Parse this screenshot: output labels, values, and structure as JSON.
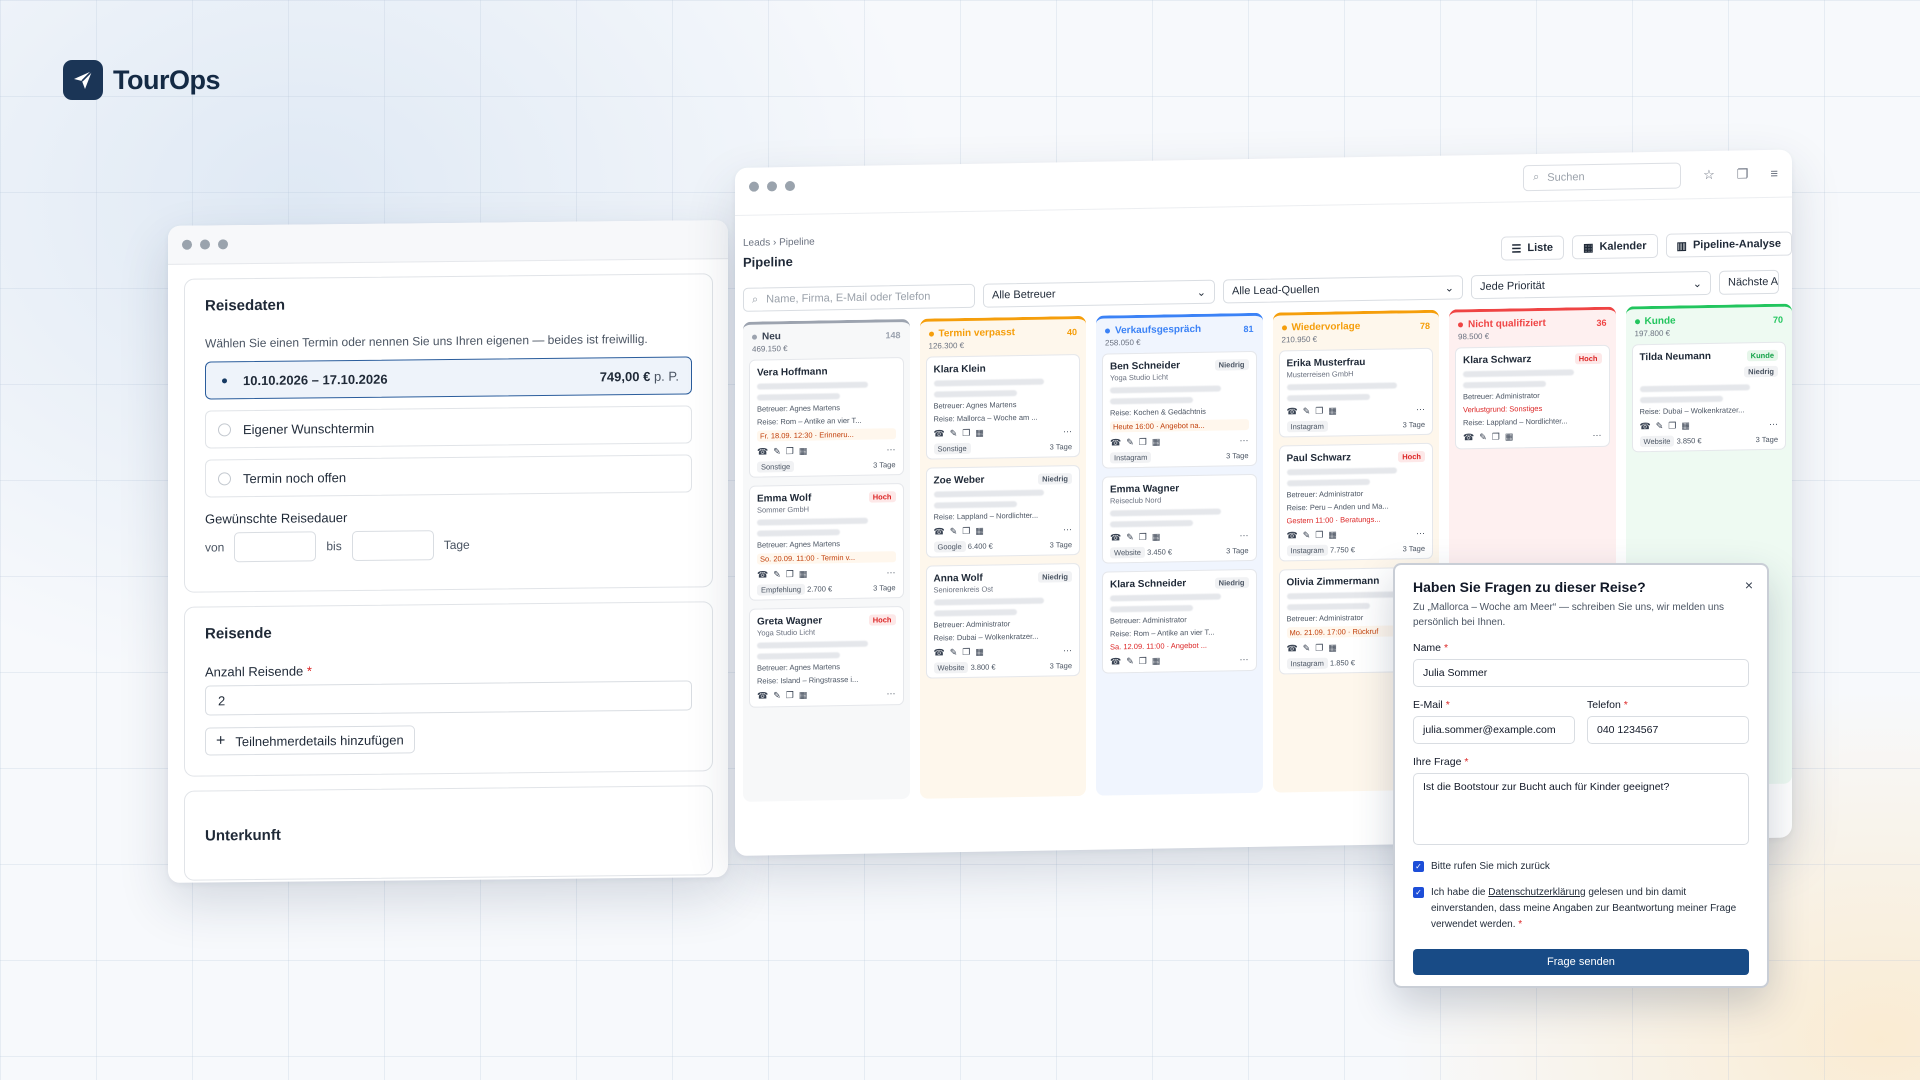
{
  "brand": {
    "name": "TourOps"
  },
  "form": {
    "reisedaten": {
      "title": "Reisedaten",
      "hint": "Wählen Sie einen Termin oder nennen Sie uns Ihren eigenen — beides ist freiwillig.",
      "options": [
        {
          "label": "10.10.2026 – 17.10.2026",
          "price": "749,00 €",
          "unit": "p. P."
        },
        {
          "label": "Eigener Wunschtermin"
        },
        {
          "label": "Termin noch offen"
        }
      ],
      "duration_label": "Gewünschte Reisedauer",
      "from": "von",
      "to": "bis",
      "unit": "Tage"
    },
    "reisende": {
      "title": "Reisende",
      "count_label": "Anzahl Reisende",
      "count_value": "2",
      "add_label": "Teilnehmerdetails hinzufügen"
    },
    "unterkunft": {
      "title": "Unterkunft"
    }
  },
  "pipeline": {
    "search_placeholder": "Suchen",
    "breadcrumb": [
      "Leads",
      "Pipeline"
    ],
    "title": "Pipeline",
    "views": [
      "Liste",
      "Kalender",
      "Pipeline-Analyse"
    ],
    "filters": {
      "search": "Name, Firma, E-Mail oder Telefon",
      "betreuer": "Alle Betreuer",
      "quellen": "Alle Lead-Quellen",
      "prio": "Jede Priorität",
      "next": "Nächste Ak"
    },
    "columns": [
      {
        "name": "Neu",
        "count": "148",
        "sum": "469.150 €",
        "color": "#9ca3af",
        "cards": [
          {
            "name": "Vera Hoffmann",
            "tag": "",
            "sub": "",
            "lines": [
              "Betreuer: Agnes Martens",
              "Reise: Rom – Antike an vier T..."
            ],
            "alert": "Fr. 18.09. 12:30 · Erinneru...",
            "alert_type": "warn",
            "src": "Sonstige",
            "val": "",
            "days": "3 Tage"
          },
          {
            "name": "Emma Wolf",
            "tag": "Hoch",
            "sub": "Sommer GmbH",
            "lines": [
              "Betreuer: Agnes Martens"
            ],
            "alert": "So. 20.09. 11:00 · Termin v...",
            "alert_type": "warn",
            "src": "Empfehlung",
            "val": "2.700 €",
            "days": "3 Tage"
          },
          {
            "name": "Greta Wagner",
            "tag": "Hoch",
            "sub": "Yoga Studio Licht",
            "lines": [
              "Betreuer: Agnes Martens",
              "Reise: Island – Ringstrasse i..."
            ],
            "alert": "",
            "alert_type": "",
            "src": "",
            "val": "",
            "days": ""
          }
        ]
      },
      {
        "name": "Termin verpasst",
        "count": "40",
        "sum": "126.300 €",
        "color": "#f59e0b",
        "cards": [
          {
            "name": "Klara Klein",
            "tag": "",
            "sub": "",
            "lines": [
              "Betreuer: Agnes Martens",
              "Reise: Mallorca – Woche am ..."
            ],
            "alert": "",
            "alert_type": "",
            "src": "Sonstige",
            "val": "",
            "days": "3 Tage"
          },
          {
            "name": "Zoe Weber",
            "tag": "Niedrig",
            "sub": "",
            "lines": [
              "Reise: Lappland – Nordlichter..."
            ],
            "alert": "",
            "alert_type": "",
            "src": "Google",
            "val": "6.400 €",
            "days": "3 Tage"
          },
          {
            "name": "Anna Wolf",
            "tag": "Niedrig",
            "sub": "Seniorenkreis Ost",
            "lines": [
              "Betreuer: Administrator",
              "Reise: Dubai – Wolkenkratzer..."
            ],
            "alert": "",
            "alert_type": "",
            "src": "Website",
            "val": "3.800 €",
            "days": "3 Tage"
          }
        ]
      },
      {
        "name": "Verkaufsgespräch",
        "count": "81",
        "sum": "258.050 €",
        "color": "#3b82f6",
        "cards": [
          {
            "name": "Ben Schneider",
            "tag": "Niedrig",
            "sub": "Yoga Studio Licht",
            "lines": [
              "Reise: Kochen & Gedächtnis"
            ],
            "alert": "Heute 16:00 · Angebot na...",
            "alert_type": "warn",
            "src": "Instagram",
            "val": "",
            "days": "3 Tage"
          },
          {
            "name": "Emma Wagner",
            "tag": "",
            "sub": "Reiseclub Nord",
            "lines": [],
            "alert": "",
            "alert_type": "",
            "src": "Website",
            "val": "3.450 €",
            "days": "3 Tage"
          },
          {
            "name": "Klara Schneider",
            "tag": "Niedrig",
            "sub": "",
            "lines": [
              "Betreuer: Administrator",
              "Reise: Rom – Antike an vier T..."
            ],
            "alert": "Sa. 12.09. 11:00 · Angebot ...",
            "alert_type": "red",
            "src": "",
            "val": "",
            "days": ""
          }
        ]
      },
      {
        "name": "Wiedervorlage",
        "count": "78",
        "sum": "210.950 €",
        "color": "#f59e0b",
        "cards": [
          {
            "name": "Erika Musterfrau",
            "tag": "",
            "sub": "Musterreisen GmbH",
            "lines": [],
            "alert": "",
            "alert_type": "",
            "src": "Instagram",
            "val": "",
            "days": "3 Tage"
          },
          {
            "name": "Paul Schwarz",
            "tag": "Hoch",
            "sub": "",
            "lines": [
              "Betreuer: Administrator",
              "Reise: Peru – Anden und Ma..."
            ],
            "alert": "Gestern 11:00 · Beratungs...",
            "alert_type": "red",
            "src": "Instagram",
            "val": "7.750 €",
            "days": "3 Tage"
          },
          {
            "name": "Olivia Zimmermann",
            "tag": "Hoch",
            "sub": "",
            "lines": [
              "Betreuer: Administrator"
            ],
            "alert": "Mo. 21.09. 17:00 · Rückruf",
            "alert_type": "warn",
            "src": "Instagram",
            "val": "1.850 €",
            "days": ""
          }
        ]
      },
      {
        "name": "Nicht qualifiziert",
        "count": "36",
        "sum": "98.500 €",
        "color": "#ef4444",
        "cards": [
          {
            "name": "Klara Schwarz",
            "tag": "Hoch",
            "sub": "",
            "lines": [
              "Betreuer: Administrator"
            ],
            "reason": "Verlustgrund: Sonstiges",
            "lines2": [
              "Reise: Lappland – Nordlichter..."
            ],
            "alert": "",
            "alert_type": "",
            "src": "",
            "val": "",
            "days": ""
          }
        ]
      },
      {
        "name": "Kunde",
        "count": "70",
        "sum": "197.800 €",
        "color": "#22c55e",
        "cards": [
          {
            "name": "Tilda Neumann",
            "tag": "Kunde",
            "tag2": "Niedrig",
            "sub": "",
            "lines": [
              "Reise: Dubai – Wolkenkratzer..."
            ],
            "alert": "",
            "alert_type": "",
            "src": "Website",
            "val": "3.850 €",
            "days": "3 Tage"
          }
        ]
      }
    ]
  },
  "modal": {
    "title": "Haben Sie Fragen zu dieser Reise?",
    "desc": "Zu „Mallorca – Woche am Meer“ — schreiben Sie uns, wir melden uns persönlich bei Ihnen.",
    "name_label": "Name",
    "name_value": "Julia Sommer",
    "email_label": "E-Mail",
    "email_value": "julia.sommer@example.com",
    "phone_label": "Telefon",
    "phone_value": "040 1234567",
    "question_label": "Ihre Frage",
    "question_value": "Ist die Bootstour zur Bucht auch für Kinder geeignet?",
    "callback_label": "Bitte rufen Sie mich zurück",
    "privacy_pre": "Ich habe die ",
    "privacy_link": "Datenschutzerklärung",
    "privacy_post": " gelesen und bin damit einverstanden, dass meine Angaben zur Beantwortung meiner Frage verwendet werden.",
    "submit": "Frage senden",
    "close": "×"
  }
}
